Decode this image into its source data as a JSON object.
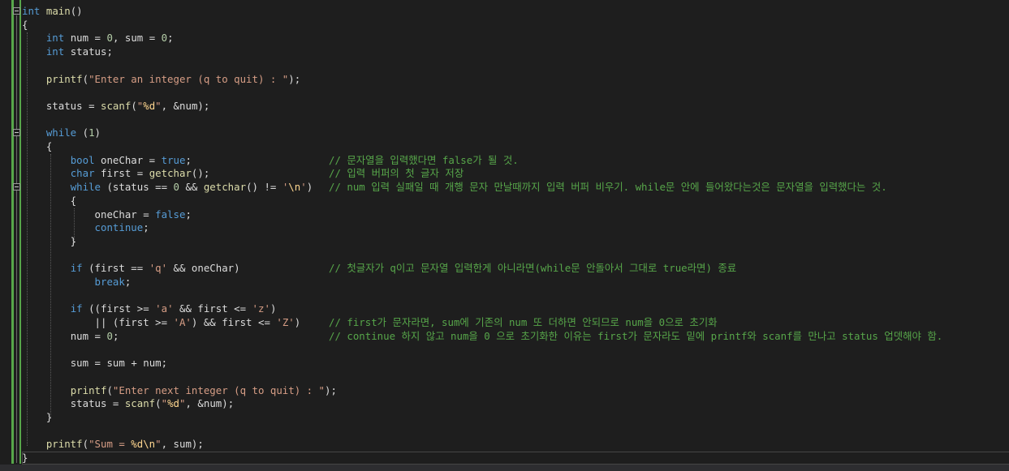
{
  "lines": [
    [
      "int main()"
    ],
    [
      "{"
    ],
    [
      "    int num = 0, sum = 0;"
    ],
    [
      "    int status;"
    ],
    [
      ""
    ],
    [
      "    printf(\"Enter an integer (q to quit) : \");"
    ],
    [
      ""
    ],
    [
      "    status = scanf(\"%d\", &num);"
    ],
    [
      ""
    ],
    [
      "    while (1)"
    ],
    [
      "    {"
    ],
    [
      "        bool oneChar = true;",
      "// 문자열을 입력했다면 false가 될 것."
    ],
    [
      "        char first = getchar();",
      "// 입력 버퍼의 첫 글자 저장"
    ],
    [
      "        while (status == 0 && getchar() != '\\n')",
      "// num 입력 실패일 때 개행 문자 만날때까지 입력 버퍼 비우기. while문 안에 들어왔다는것은 문자열을 입력했다는 것."
    ],
    [
      "        {"
    ],
    [
      "            oneChar = false;"
    ],
    [
      "            continue;"
    ],
    [
      "        }"
    ],
    [
      ""
    ],
    [
      "        if (first == 'q' && oneChar)",
      "// 첫글자가 q이고 문자열 입력한게 아니라면(while문 안돌아서 그대로 true라면) 종료"
    ],
    [
      "            break;"
    ],
    [
      ""
    ],
    [
      "        if ((first >= 'a' && first <= 'z')"
    ],
    [
      "            || (first >= 'A') && first <= 'Z')",
      "// first가 문자라면, sum에 기존의 num 또 더하면 안되므로 num을 0으로 초기화"
    ],
    [
      "        num = 0;",
      "// continue 하지 않고 num을 0 으로 초기화한 이유는 first가 문자라도 밑에 printf와 scanf를 만나고 status 업뎃해야 함."
    ],
    [
      ""
    ],
    [
      "        sum = sum + num;"
    ],
    [
      ""
    ],
    [
      "        printf(\"Enter next integer (q to quit) : \");"
    ],
    [
      "        status = scanf(\"%d\", &num);"
    ],
    [
      "    }"
    ],
    [
      ""
    ],
    [
      "    printf(\"Sum = %d\\n\", sum);"
    ],
    [
      "}"
    ]
  ],
  "colors": {
    "background": "#1e1e1e",
    "keyword": "#569cd6",
    "function": "#dcdcaa",
    "string": "#d69d85",
    "number": "#b5cea8",
    "comment": "#57a64a",
    "identifier": "#dcdcdc"
  }
}
